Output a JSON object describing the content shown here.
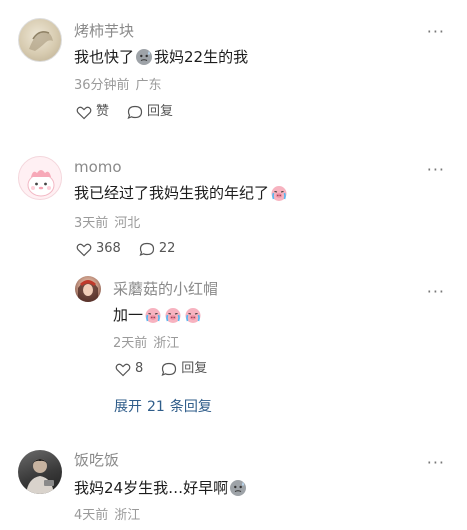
{
  "comments": [
    {
      "username": "烤柿芋块",
      "text_a": "我也快了",
      "text_b": "我妈22生的我",
      "time": "36分钟前",
      "location": "广东",
      "like_label": "赞",
      "reply_label": "回复"
    },
    {
      "username": "momo",
      "text_a": "我已经过了我妈生我的年纪了",
      "time": "3天前",
      "location": "河北",
      "like_count": "368",
      "reply_count": "22",
      "replies": [
        {
          "username": "采蘑菇的小红帽",
          "text_a": "加一",
          "time": "2天前",
          "location": "浙江",
          "like_count": "8",
          "reply_label": "回复"
        }
      ],
      "expand_prefix": "展开",
      "expand_count": "21",
      "expand_suffix": "条回复"
    },
    {
      "username": "饭吃饭",
      "text_a": "我妈24岁生我…好早啊",
      "time": "4天前",
      "location": "浙江"
    }
  ],
  "icons": {
    "more": "more-dots-icon",
    "like": "heart-outline-icon",
    "reply": "speech-bubble-icon",
    "emoji_sweat": "sweat-face-emoji",
    "emoji_cry_pig": "crying-pig-emoji"
  },
  "colors": {
    "username": "#8a8a8a",
    "meta": "#9a9a9a",
    "link": "#2f5d8a",
    "body_text": "#1c1c1c"
  }
}
